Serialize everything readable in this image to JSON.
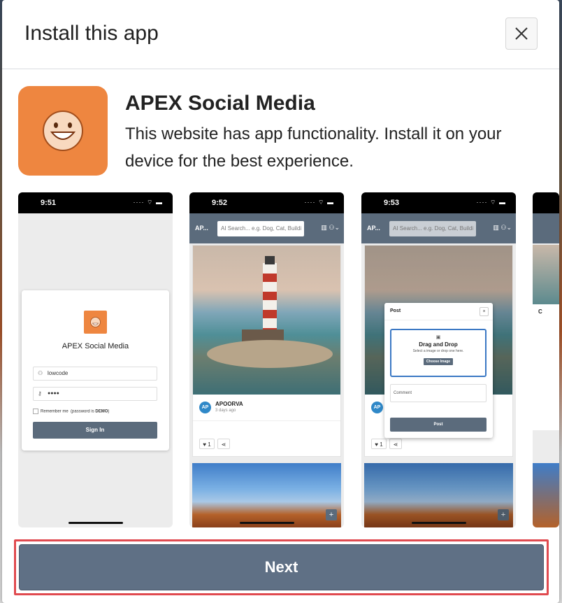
{
  "dialog": {
    "title": "Install this app",
    "close_icon": "close-icon",
    "next_label": "Next"
  },
  "app": {
    "name": "APEX Social Media",
    "description": "This website has app functionality. Install it on your device for the best experience.",
    "icon": "smiley-face-icon",
    "icon_color": "#ee8640"
  },
  "screenshots": [
    {
      "time": "9:51",
      "login": {
        "title": "APEX Social Media",
        "username": "lowcode",
        "password_mask": "●●●●",
        "remember_label": "Remember me",
        "remember_hint_prefix": "(password is",
        "remember_hint_value": "DEMO",
        "remember_hint_suffix": ")",
        "signin_label": "Sign In"
      }
    },
    {
      "time": "9:52",
      "appbar_label": "AP...",
      "search_placeholder": "AI Search... e.g. Dog, Cat, Buildi",
      "post": {
        "author": "APOORVA",
        "avatar_initials": "AP",
        "date": "3 days ago",
        "likes": "1"
      }
    },
    {
      "time": "9:53",
      "appbar_label": "AP...",
      "search_placeholder": "AI Search... e.g. Dog, Cat, Buildi",
      "modal": {
        "title": "Post",
        "drop_title": "Drag and Drop",
        "drop_hint": "Select a image or drop one here.",
        "choose_label": "Choose Image",
        "comment_placeholder": "Comment",
        "post_label": "Post"
      },
      "avatar_initials": "AP",
      "likes": "1"
    },
    {
      "partial_label": "C"
    }
  ],
  "colors": {
    "primary_button": "#5f7085",
    "highlight_border": "#e04a4f",
    "appbar": "#5b6b7c"
  }
}
